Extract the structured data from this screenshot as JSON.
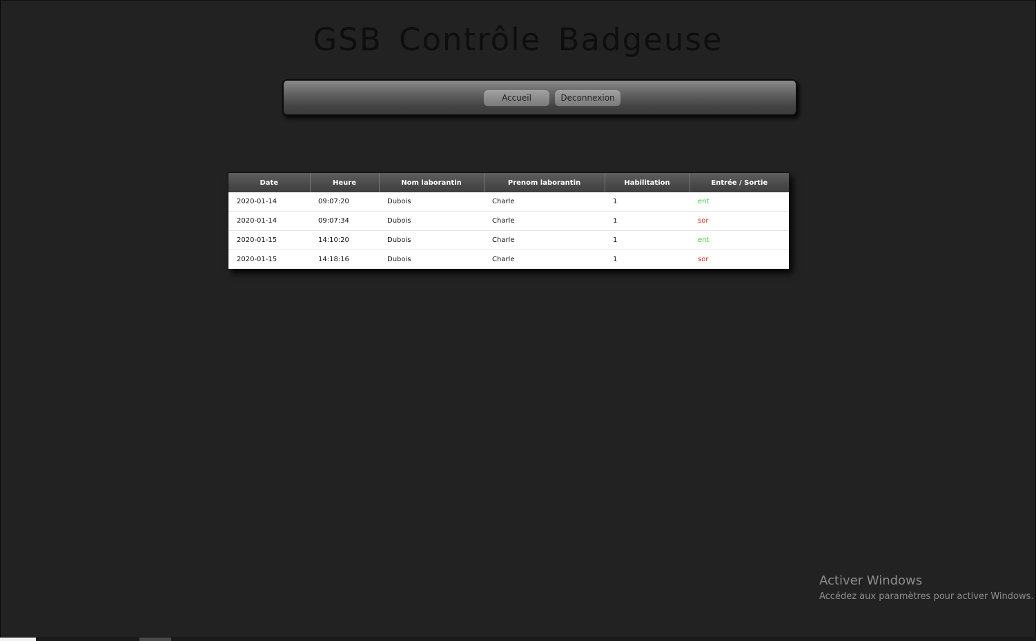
{
  "header": {
    "title": "GSB Contrôle Badgeuse"
  },
  "nav": {
    "home_label": "Accueil",
    "logout_label": "Deconnexion"
  },
  "table": {
    "columns": [
      "Date",
      "Heure",
      "Nom laborantin",
      "Prenom laborantin",
      "Habilitation",
      "Entrée / Sortie"
    ],
    "rows": [
      {
        "date": "2020-01-14",
        "time": "09:07:20",
        "last_name": "Dubois",
        "first_name": "Charle",
        "clearance": "1",
        "direction": "ent"
      },
      {
        "date": "2020-01-14",
        "time": "09:07:34",
        "last_name": "Dubois",
        "first_name": "Charle",
        "clearance": "1",
        "direction": "sor"
      },
      {
        "date": "2020-01-15",
        "time": "14:10:20",
        "last_name": "Dubois",
        "first_name": "Charle",
        "clearance": "1",
        "direction": "ent"
      },
      {
        "date": "2020-01-15",
        "time": "14:18:16",
        "last_name": "Dubois",
        "first_name": "Charle",
        "clearance": "1",
        "direction": "sor"
      }
    ]
  },
  "colors": {
    "background": "#232223",
    "entry": "#2ecc2e",
    "exit": "#e02020"
  },
  "watermark": {
    "title": "Activer Windows",
    "subtitle": "Accédez aux paramètres pour activer Windows."
  }
}
